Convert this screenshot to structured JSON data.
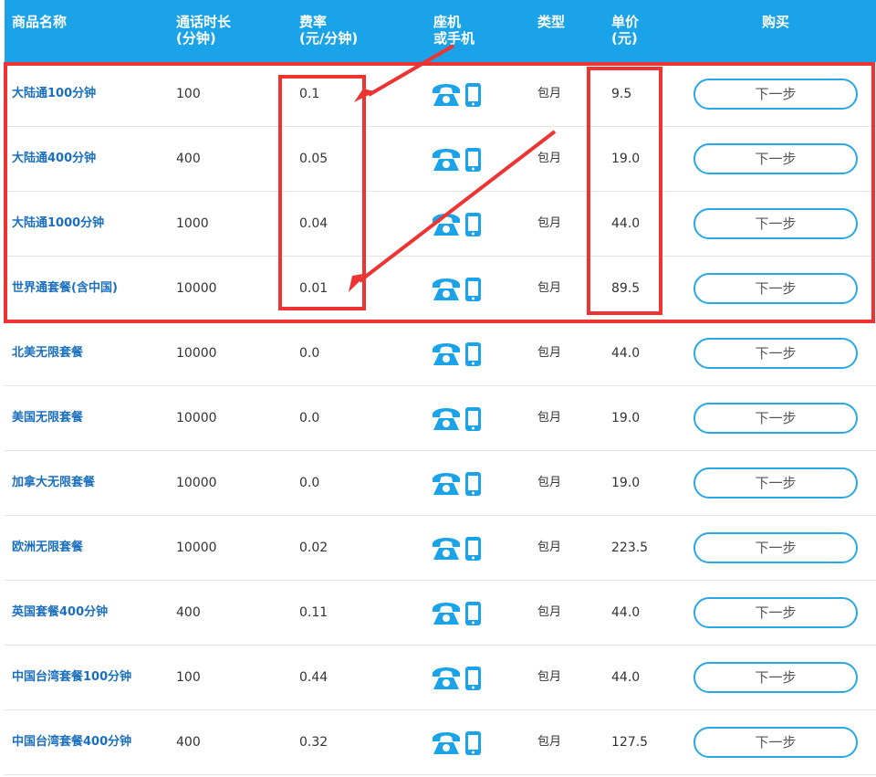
{
  "header": {
    "name": "商品名称",
    "duration_line1": "通话时长",
    "duration_line2": "(分钟)",
    "rate_line1": "费率",
    "rate_line2": "(元/分钟)",
    "device_line1": "座机",
    "device_line2": "或手机",
    "type": "类型",
    "price_line1": "单价",
    "price_line2": "(元)",
    "buy": "购买"
  },
  "rows": [
    {
      "name": "大陆通100分钟",
      "minutes": "100",
      "rate": "0.1",
      "type": "包月",
      "price": "9.5",
      "button": "下一步"
    },
    {
      "name": "大陆通400分钟",
      "minutes": "400",
      "rate": "0.05",
      "type": "包月",
      "price": "19.0",
      "button": "下一步"
    },
    {
      "name": "大陆通1000分钟",
      "minutes": "1000",
      "rate": "0.04",
      "type": "包月",
      "price": "44.0",
      "button": "下一步"
    },
    {
      "name": "世界通套餐(含中国)",
      "minutes": "10000",
      "rate": "0.01",
      "type": "包月",
      "price": "89.5",
      "button": "下一步"
    },
    {
      "name": "北美无限套餐",
      "minutes": "10000",
      "rate": "0.0",
      "type": "包月",
      "price": "44.0",
      "button": "下一步"
    },
    {
      "name": "美国无限套餐",
      "minutes": "10000",
      "rate": "0.0",
      "type": "包月",
      "price": "19.0",
      "button": "下一步"
    },
    {
      "name": "加拿大无限套餐",
      "minutes": "10000",
      "rate": "0.0",
      "type": "包月",
      "price": "19.0",
      "button": "下一步"
    },
    {
      "name": "欧洲无限套餐",
      "minutes": "10000",
      "rate": "0.02",
      "type": "包月",
      "price": "223.5",
      "button": "下一步"
    },
    {
      "name": "英国套餐400分钟",
      "minutes": "400",
      "rate": "0.11",
      "type": "包月",
      "price": "44.0",
      "button": "下一步"
    },
    {
      "name": "中国台湾套餐100分钟",
      "minutes": "100",
      "rate": "0.44",
      "type": "包月",
      "price": "44.0",
      "button": "下一步"
    },
    {
      "name": "中国台湾套餐400分钟",
      "minutes": "400",
      "rate": "0.32",
      "type": "包月",
      "price": "127.5",
      "button": "下一步"
    }
  ],
  "icons": {
    "landline": "landline-phone-icon",
    "mobile": "mobile-phone-icon"
  },
  "colors": {
    "header_bg": "#1aa3e8",
    "name_text": "#1b6fbf",
    "button_border": "#29a8e6",
    "annotation": "#ee3333"
  }
}
